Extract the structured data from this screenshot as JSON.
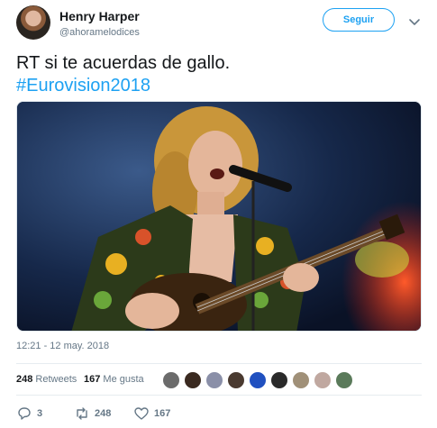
{
  "user": {
    "name": "Henry Harper",
    "handle": "@ahoramelodices"
  },
  "follow_button": {
    "label": "Seguir"
  },
  "tweet": {
    "text": "RT si te acuerdas de gallo.",
    "hashtag": "#Eurovision2018"
  },
  "timestamp": "12:21 - 12 may. 2018",
  "stats": {
    "retweets_count": "248",
    "retweets_label": "Retweets",
    "likes_count": "167",
    "likes_label": "Me gusta"
  },
  "actions": {
    "replies": "3",
    "retweets": "248",
    "likes": "167"
  },
  "colors": {
    "accent": "#1da1f2",
    "secondary_text": "#657786"
  },
  "icons": [
    "caret-down-icon",
    "reply-icon",
    "retweet-icon",
    "heart-icon"
  ]
}
